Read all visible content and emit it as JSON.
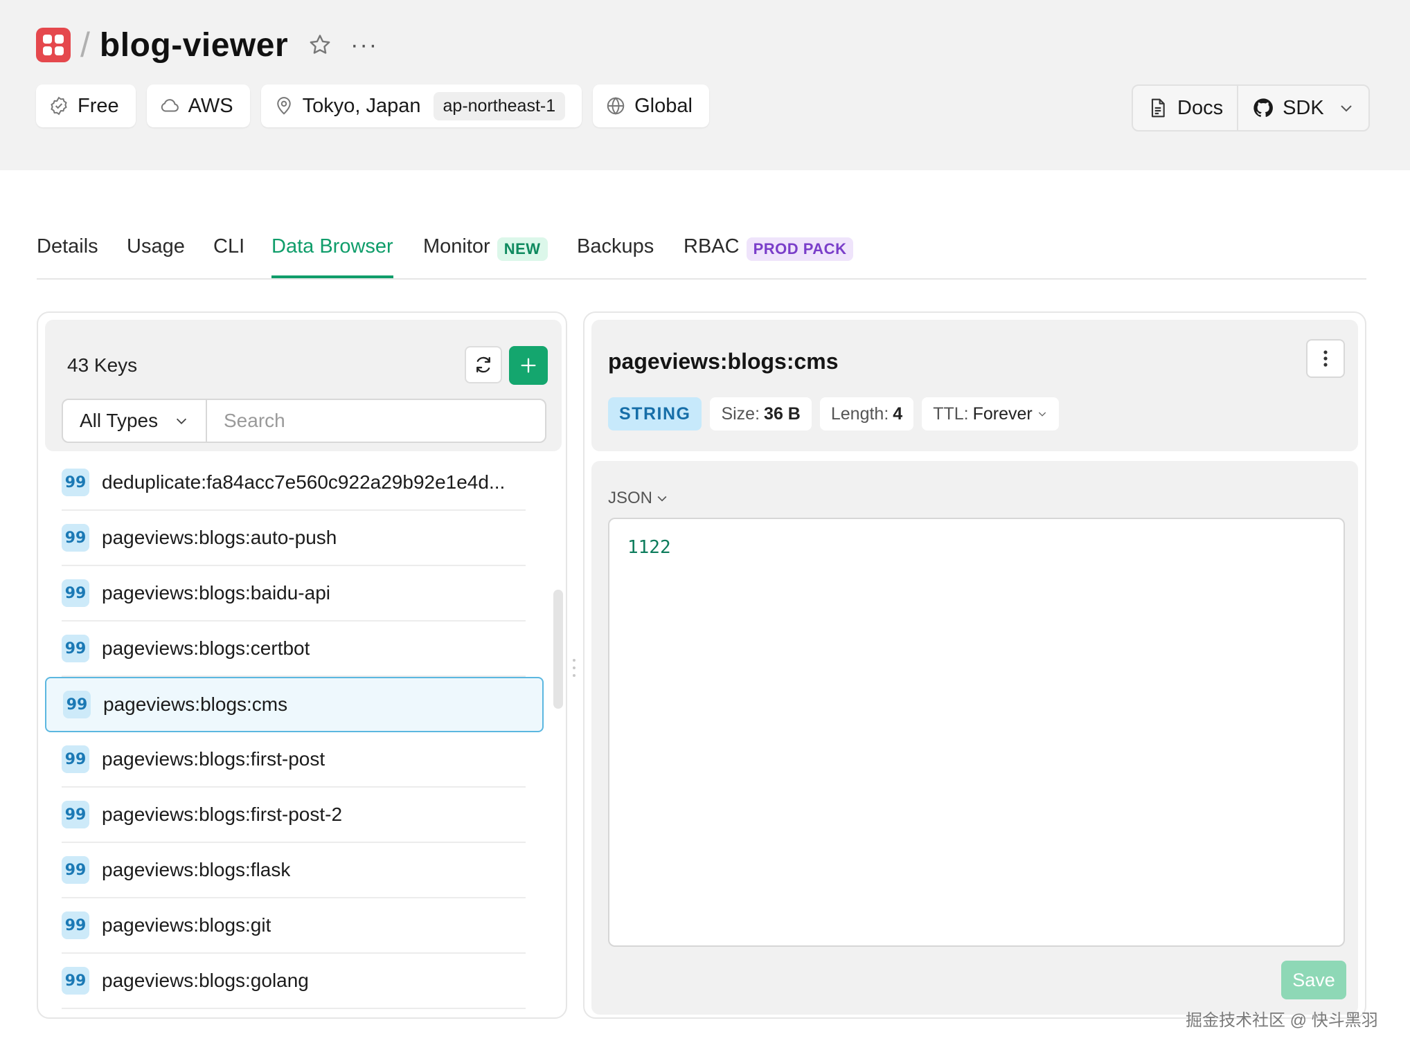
{
  "header": {
    "project_name": "blog-viewer",
    "separator": "/",
    "more": "···",
    "chips": {
      "plan": "Free",
      "provider": "AWS",
      "region": "Tokyo, Japan",
      "region_code": "ap-northeast-1",
      "scope": "Global"
    },
    "docs_label": "Docs",
    "sdk_label": "SDK"
  },
  "tabs": {
    "details": "Details",
    "usage": "Usage",
    "cli": "CLI",
    "data_browser": "Data Browser",
    "monitor": "Monitor",
    "monitor_badge": "NEW",
    "backups": "Backups",
    "rbac": "RBAC",
    "rbac_badge": "PROD PACK",
    "active": "Data Browser"
  },
  "key_panel": {
    "count_label": "43 Keys",
    "type_filter": "All Types",
    "search_placeholder": "Search",
    "keys": [
      {
        "name": "deduplicate:fa84acc7e560c922a29b92e1e4d...",
        "icon": "string-quote-icon"
      },
      {
        "name": "pageviews:blogs:auto-push",
        "icon": "string-quote-icon"
      },
      {
        "name": "pageviews:blogs:baidu-api",
        "icon": "string-quote-icon"
      },
      {
        "name": "pageviews:blogs:certbot",
        "icon": "string-quote-icon"
      },
      {
        "name": "pageviews:blogs:cms",
        "icon": "string-quote-icon",
        "selected": true
      },
      {
        "name": "pageviews:blogs:first-post",
        "icon": "string-quote-icon"
      },
      {
        "name": "pageviews:blogs:first-post-2",
        "icon": "string-quote-icon"
      },
      {
        "name": "pageviews:blogs:flask",
        "icon": "string-quote-icon"
      },
      {
        "name": "pageviews:blogs:git",
        "icon": "string-quote-icon"
      },
      {
        "name": "pageviews:blogs:golang",
        "icon": "string-quote-icon"
      }
    ],
    "key_icon_glyph": "99"
  },
  "detail": {
    "key_name": "pageviews:blogs:cms",
    "type": "STRING",
    "size_label": "Size:",
    "size_value": "36 B",
    "length_label": "Length:",
    "length_value": "4",
    "ttl_label": "TTL:",
    "ttl_value": "Forever",
    "format": "JSON",
    "value": "1122",
    "save_label": "Save"
  },
  "watermark": "掘金技术社区 @ 快斗黑羽",
  "colors": {
    "accent": "#0f9d6a",
    "logo": "#e5484d",
    "string_badge": "#c7e9fb",
    "selected_row": "#eef8fd"
  }
}
